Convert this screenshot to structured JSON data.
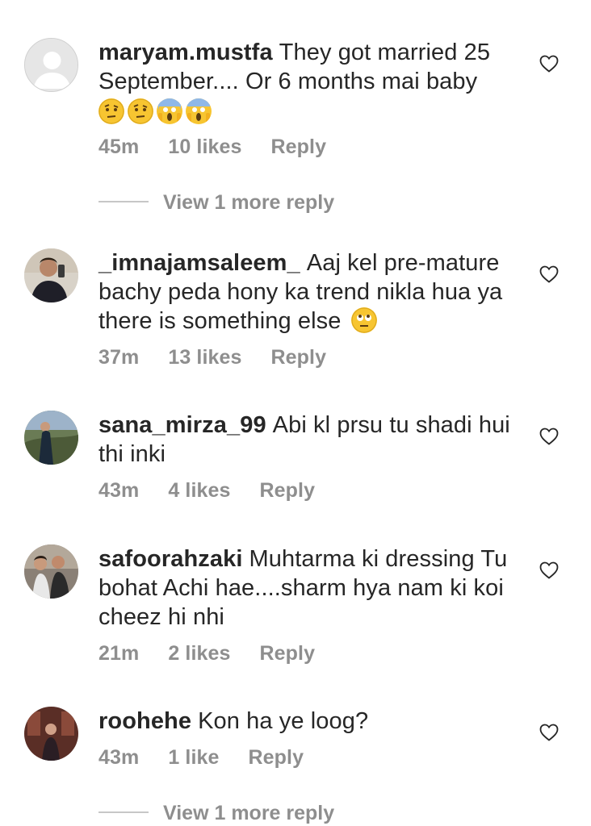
{
  "comments": [
    {
      "username": "maryam.mustfa",
      "text": "They got married 25 September.... Or 6 months mai baby",
      "time": "45m",
      "likes": "10 likes",
      "reply": "Reply",
      "emojis": [
        "raised-eyebrow-emoji",
        "raised-eyebrow-emoji",
        "face-screaming-emoji",
        "face-screaming-emoji"
      ],
      "avatar": "default-avatar-icon"
    },
    {
      "username": "_imnajamsaleem_",
      "text": "Aaj kel pre-mature bachy peda hony ka trend nikla hua ya there is something else",
      "time": "37m",
      "likes": "13 likes",
      "reply": "Reply",
      "emojis": [
        "eye-roll-emoji"
      ]
    },
    {
      "username": "sana_mirza_99",
      "text": "Abi kl prsu tu shadi hui thi inki",
      "time": "43m",
      "likes": "4 likes",
      "reply": "Reply"
    },
    {
      "username": "safoorahzaki",
      "text": "Muhtarma ki dressing Tu bohat Achi hae....sharm hya nam ki koi cheez hi nhi",
      "time": "21m",
      "likes": "2 likes",
      "reply": "Reply"
    },
    {
      "username": "roohehe",
      "text": "Kon ha ye loog?",
      "time": "43m",
      "likes": "1 like",
      "reply": "Reply"
    }
  ],
  "view_more": {
    "first": "View 1 more reply",
    "last": "View 1 more reply"
  },
  "colors": {
    "text": "#262626",
    "meta": "#8e8e8e",
    "divider": "#c7c7c7"
  }
}
